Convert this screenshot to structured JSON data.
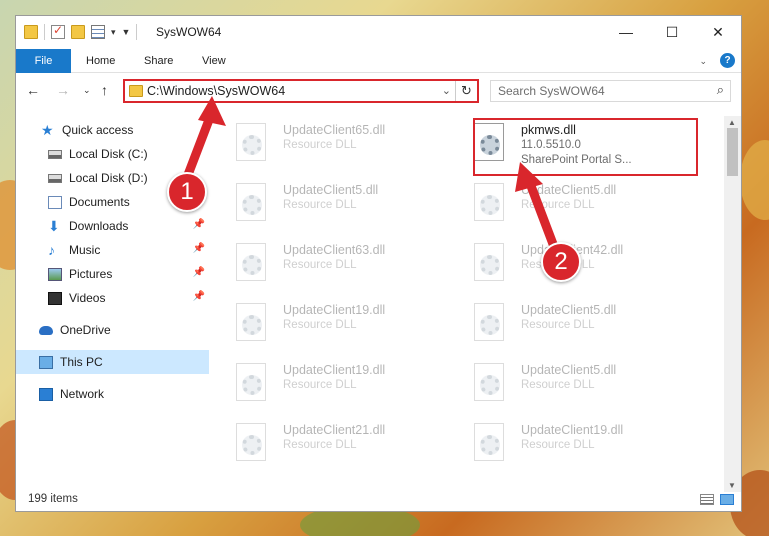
{
  "window": {
    "title": "SysWOW64"
  },
  "ribbon": {
    "tabs": [
      "File",
      "Home",
      "Share",
      "View"
    ],
    "help_label": "?"
  },
  "address": {
    "path": "C:\\Windows\\SysWOW64"
  },
  "search": {
    "placeholder": "Search SysWOW64"
  },
  "nav": {
    "items": [
      {
        "label": "Quick access"
      },
      {
        "label": "Local Disk (C:)"
      },
      {
        "label": "Local Disk (D:)"
      },
      {
        "label": "Documents"
      },
      {
        "label": "Downloads"
      },
      {
        "label": "Music"
      },
      {
        "label": "Pictures"
      },
      {
        "label": "Videos"
      },
      {
        "label": "OneDrive"
      },
      {
        "label": "This PC"
      },
      {
        "label": "Network"
      }
    ]
  },
  "files": {
    "highlighted": {
      "name": "pkmws.dll",
      "version": "11.0.5510.0",
      "description": "SharePoint Portal S..."
    },
    "left": [
      {
        "name": "UpdateClient65.dll",
        "type": "Resource DLL"
      },
      {
        "name": "UpdateClient5.dll",
        "type": "Resource DLL"
      },
      {
        "name": "UpdateClient63.dll",
        "type": "Resource DLL"
      },
      {
        "name": "UpdateClient19.dll",
        "type": "Resource DLL"
      },
      {
        "name": "UpdateClient19.dll",
        "type": "Resource DLL"
      },
      {
        "name": "UpdateClient21.dll",
        "type": "Resource DLL"
      }
    ],
    "right": [
      {
        "name": "UpdateClient5.dll",
        "type": "Resource DLL"
      },
      {
        "name": "UpdateClient42.dll",
        "type": "Resource DLL"
      },
      {
        "name": "UpdateClient5.dll",
        "type": "Resource DLL"
      },
      {
        "name": "UpdateClient5.dll",
        "type": "Resource DLL"
      },
      {
        "name": "UpdateClient19.dll",
        "type": "Resource DLL"
      }
    ]
  },
  "status": {
    "item_count": "199 items"
  },
  "annotations": {
    "step1": "1",
    "step2": "2",
    "color": "#d9262c"
  }
}
